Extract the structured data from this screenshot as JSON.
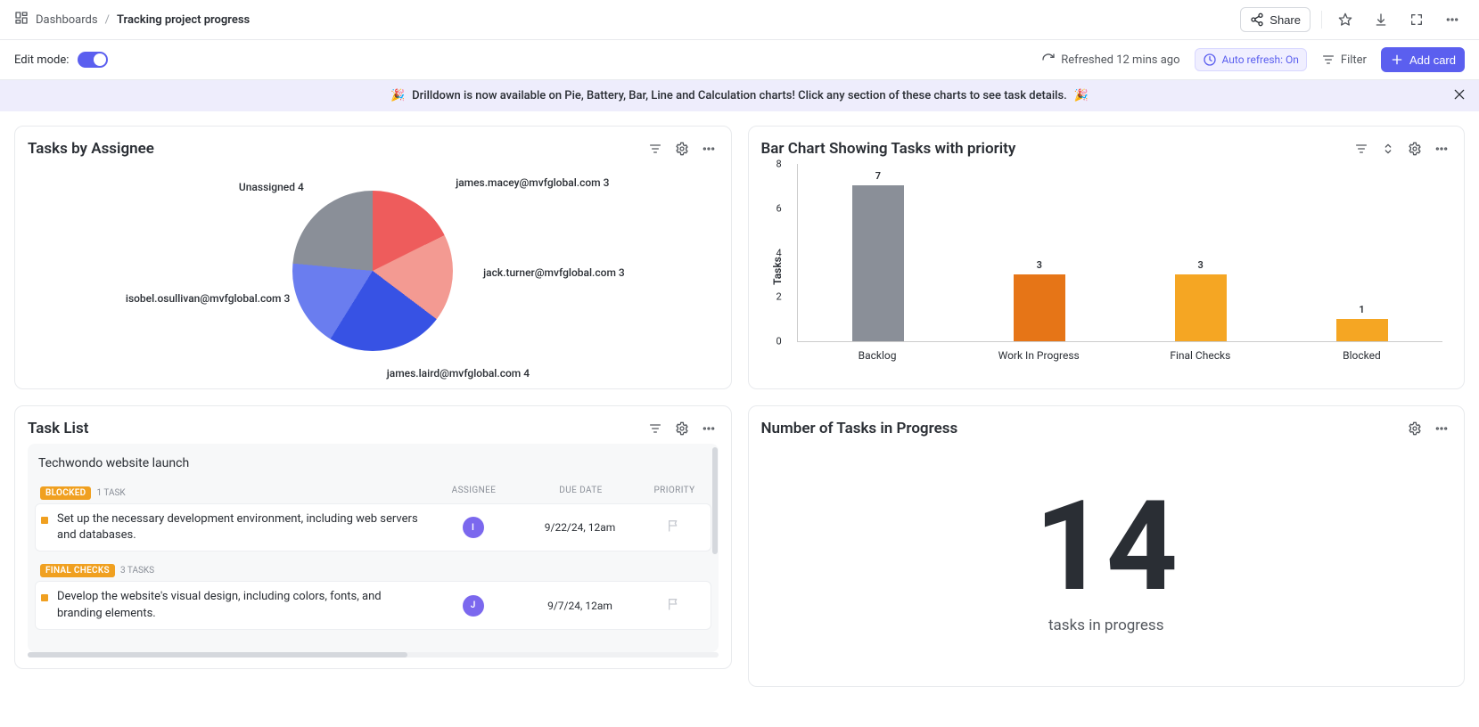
{
  "header": {
    "breadcrumb_root": "Dashboards",
    "breadcrumb_current": "Tracking project progress",
    "share_label": "Share"
  },
  "editbar": {
    "label": "Edit mode:",
    "refreshed_text": "Refreshed 12 mins ago",
    "autorefresh_label": "Auto refresh: On",
    "filter_label": "Filter",
    "addcard_label": "Add card"
  },
  "banner": {
    "text": "Drilldown is now available on Pie, Battery, Bar, Line and Calculation charts! Click any section of these charts to see task details."
  },
  "pie": {
    "title": "Tasks by Assignee"
  },
  "bar": {
    "title": "Bar Chart Showing Tasks with priority",
    "ylabel": "Tasks"
  },
  "tasklist": {
    "title": "Task List",
    "project": "Techwondo website launch",
    "columns": {
      "assignee": "ASSIGNEE",
      "due": "DUE DATE",
      "priority": "PRIORITY"
    },
    "groups": [
      {
        "badge": "BLOCKED",
        "badge_class": "blocked",
        "count": "1 TASK",
        "rows": [
          {
            "title": "Set up the necessary development environment, including web servers and databases.",
            "avatar": "I",
            "due": "9/22/24, 12am"
          }
        ]
      },
      {
        "badge": "FINAL CHECKS",
        "badge_class": "finalchecks",
        "count": "3 TASKS",
        "rows": [
          {
            "title": "Develop the website's visual design, including colors, fonts, and branding elements.",
            "avatar": "J",
            "due": "9/7/24, 12am"
          }
        ]
      }
    ]
  },
  "number": {
    "title": "Number of Tasks in Progress",
    "value": "14",
    "caption": "tasks in progress"
  },
  "chart_data": [
    {
      "type": "pie",
      "title": "Tasks by Assignee",
      "series": [
        {
          "name": "james.macey@mvfglobal.com",
          "value": 3,
          "color": "#ee5c5c"
        },
        {
          "name": "jack.turner@mvfglobal.com",
          "value": 3,
          "color": "#f39a92"
        },
        {
          "name": "james.laird@mvfglobal.com",
          "value": 4,
          "color": "#3752e4"
        },
        {
          "name": "isobel.osullivan@mvfglobal.com",
          "value": 3,
          "color": "#6a7def"
        },
        {
          "name": "Unassigned",
          "value": 4,
          "color": "#8a8f98"
        }
      ]
    },
    {
      "type": "bar",
      "title": "Bar Chart Showing Tasks with priority",
      "ylabel": "Tasks",
      "ylim": [
        0,
        8
      ],
      "yticks": [
        0,
        2,
        4,
        6,
        8
      ],
      "categories": [
        "Backlog",
        "Work In Progress",
        "Final Checks",
        "Blocked"
      ],
      "values": [
        7,
        3,
        3,
        1
      ],
      "colors": [
        "#8a8f98",
        "#e67517",
        "#f5a623",
        "#f5a623"
      ]
    }
  ]
}
